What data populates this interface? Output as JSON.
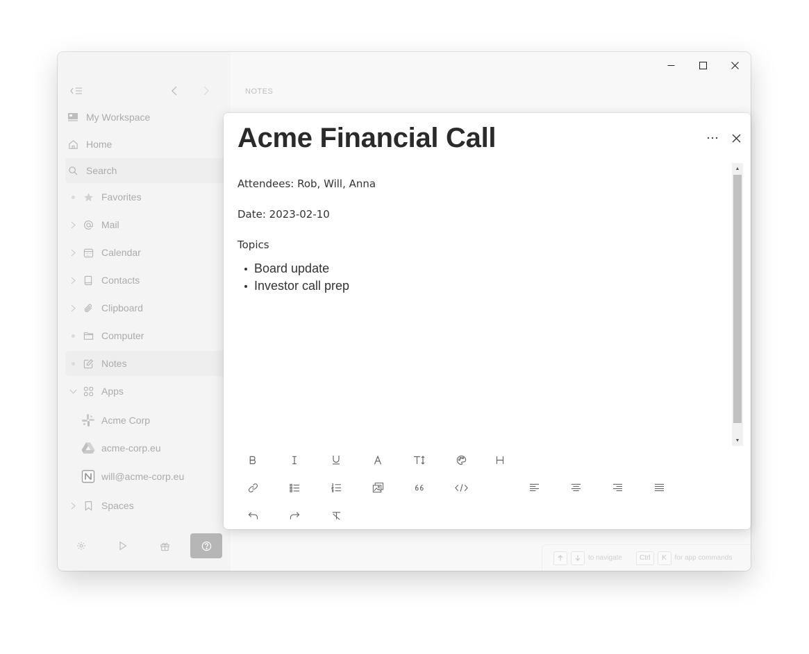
{
  "sidebar": {
    "top_items": [
      {
        "label": "My Workspace",
        "icon": "workspace-icon"
      },
      {
        "label": "Home",
        "icon": "home-icon"
      },
      {
        "label": "Search",
        "icon": "search-icon"
      }
    ],
    "items": [
      {
        "label": "Favorites",
        "icon": "star-icon",
        "lead": "dot"
      },
      {
        "label": "Mail",
        "icon": "at-sign-icon",
        "lead": "chevron"
      },
      {
        "label": "Calendar",
        "icon": "calendar-icon",
        "lead": "chevron"
      },
      {
        "label": "Contacts",
        "icon": "contacts-book-icon",
        "lead": "chevron"
      },
      {
        "label": "Clipboard",
        "icon": "paperclip-icon",
        "lead": "chevron"
      },
      {
        "label": "Computer",
        "icon": "folder-icon",
        "lead": "dot"
      },
      {
        "label": "Notes",
        "icon": "edit-note-icon",
        "lead": "dot",
        "selected": true
      },
      {
        "label": "Apps",
        "icon": "apps-grid-icon",
        "lead": "chevron-down"
      }
    ],
    "apps": [
      {
        "label": "Acme Corp",
        "icon": "slack-logo-icon"
      },
      {
        "label": "acme-corp.eu",
        "icon": "google-drive-logo-icon"
      },
      {
        "label": "will@acme-corp.eu",
        "icon": "notion-logo-icon"
      }
    ],
    "spaces": {
      "label": "Spaces",
      "icon": "bookmark-icon"
    }
  },
  "main": {
    "section_label": "NOTES",
    "hint": {
      "navigate": "to navigate",
      "ctrl_key": "Ctrl",
      "k_key": "K",
      "app_commands": "for app commands"
    }
  },
  "note": {
    "title": "Acme Financial Call",
    "attendees": "Attendees: Rob, Will, Anna",
    "date": "Date: 2023-02-10",
    "topics_heading": "Topics",
    "bullets": [
      "Board update",
      "Investor call prep"
    ]
  },
  "colors": {
    "sidebar_bg": "#ebebeb",
    "main_bg": "#f3f3f3",
    "help_button_bg": "#7a7a7a",
    "title_text": "#2a2a2a"
  }
}
